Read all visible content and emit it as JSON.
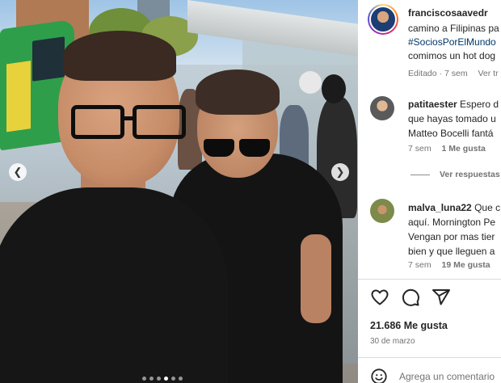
{
  "post": {
    "author": "franciscosaavedr",
    "caption_line1": "camino a Filipinas pa",
    "caption_hashtag": "#SociosPorElMundo",
    "caption_line3": "comimos un hot dog",
    "edited": "Editado",
    "time": "7 sem",
    "see_translation": "Ver tr"
  },
  "comments": [
    {
      "username": "patitaester",
      "text_first": "Espero d",
      "lines": [
        "que hayas tomado u",
        "Matteo Bocelli fantá"
      ],
      "time": "7 sem",
      "likes": "1 Me gusta"
    },
    {
      "username": "malva_luna22",
      "text_first": "Que c",
      "lines": [
        "aquí. Mornington Pe",
        "Vengan por mas tier",
        "bien y que lleguen a"
      ],
      "time": "7 sem",
      "likes": "19 Me gusta"
    }
  ],
  "view_replies": "Ver respuestas",
  "likes_count": "21.686 Me gusta",
  "post_date": "30 de marzo",
  "add_comment_placeholder": "Agrega un comentario",
  "carousel": {
    "total_dots": 6,
    "active_dot": 3
  }
}
